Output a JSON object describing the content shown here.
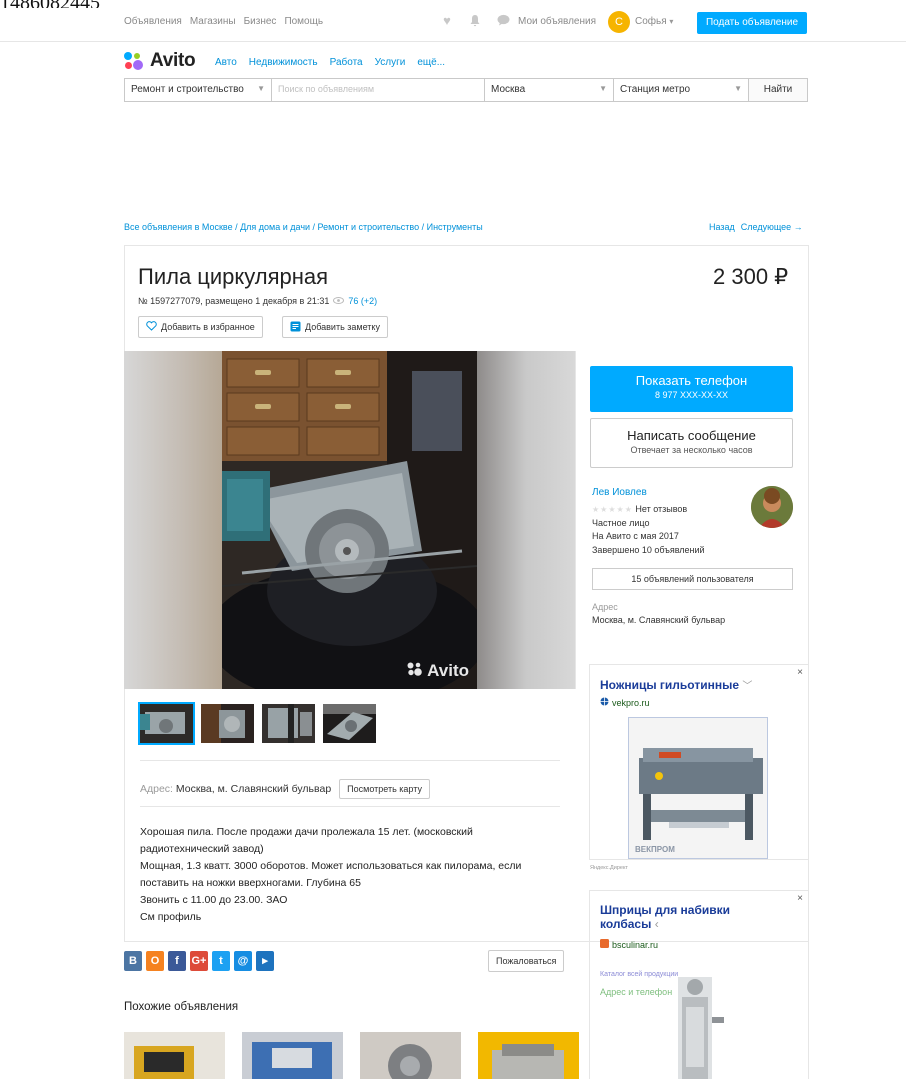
{
  "topcut_text": "1486082445",
  "topnav": {
    "links": [
      "Объявления",
      "Магазины",
      "Бизнес",
      "Помощь"
    ],
    "my_ads": "Мои объявления",
    "user_initial": "С",
    "user_name": "Софья",
    "post_button": "Подать объявление"
  },
  "logo": {
    "text": "Avito"
  },
  "categories": [
    "Авто",
    "Недвижимость",
    "Работа",
    "Услуги",
    "ещё..."
  ],
  "search": {
    "category": "Ремонт и строительство",
    "placeholder": "Поиск по объявлениям",
    "city": "Москва",
    "metro": "Станция метро",
    "find_button": "Найти"
  },
  "breadcrumbs": "Все объявления в Москве / Для дома и дачи / Ремонт и строительство / Инструменты",
  "pager": {
    "back": "Назад",
    "next": "Следующее →"
  },
  "listing": {
    "title": "Пила циркулярная",
    "price": "2 300 ₽",
    "meta": "№ 1597277079, размещено 1 декабря в 21:31",
    "views": "76 (+2)",
    "fav_button": "Добавить в избранное",
    "note_button": "Добавить заметку",
    "watermark": "Avito",
    "address_label": "Адрес:",
    "address": "Москва, м. Славянский бульвар",
    "map_button": "Посмотреть карту",
    "description": [
      "Хорошая пила. После продажи дачи пролежала 15 лет. (московский",
      "радиотехнический завод)",
      "Мощная, 1.3 кватт. 3000 оборотов. Может использоваться как пилорама, если",
      "поставить на ножки вверхногами. Глубина 65",
      "Звонить с 11.00 до 23.00. ЗАО",
      "См профиль"
    ],
    "report_button": "Пожаловаться",
    "similar_title": "Похожие объявления"
  },
  "share_icons": [
    "В",
    "О",
    "f",
    "G+",
    "t",
    "@",
    "▸"
  ],
  "seller": {
    "phone_button": "Показать телефон",
    "phone_masked": "8 977 XXX-XX-XX",
    "message_button": "Написать сообщение",
    "message_sub": "Отвечает за несколько часов",
    "name": "Лев Иовлев",
    "reviews": "Нет отзывов",
    "type": "Частное лицо",
    "since": "На Авито с мая 2017",
    "completed": "Завершено 10 объявлений",
    "ads_button": "15 объявлений пользователя",
    "address_label": "Адрес",
    "address": "Москва, м. Славянский бульвар"
  },
  "ad1": {
    "title": "Ножницы гильотинные",
    "domain": "vekpro.ru",
    "brand": "ВЕКПРОМ",
    "close": "×",
    "footer": "Яндекс.Директ"
  },
  "ad2": {
    "title_1": "Шприцы для набивки",
    "title_2": "колбасы",
    "domain": "bsculinar.ru",
    "link_1": "Каталог всей продукции",
    "link_2": "Адрес и телефон",
    "close": "×"
  },
  "colors": {
    "accent": "#00aaff",
    "link": "#0091d9",
    "user": "#f6b400"
  }
}
